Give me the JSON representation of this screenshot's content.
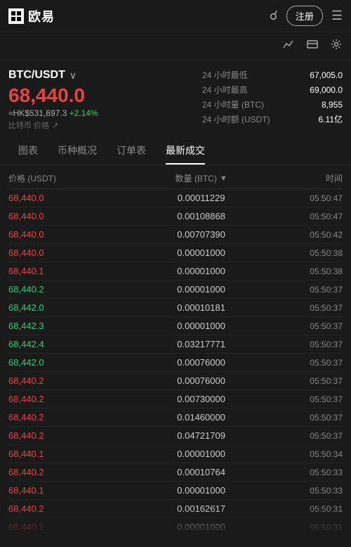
{
  "header": {
    "logo_text": "欧易",
    "register_label": "注册",
    "icons": [
      "search",
      "register",
      "menu"
    ]
  },
  "toolbar": {
    "icons": [
      "chart-line",
      "card",
      "settings"
    ]
  },
  "market": {
    "pair": "BTC/USDT",
    "pair_arrow": "∨",
    "price": "68,440.0",
    "price_hkd": "≈HK$531,697.3",
    "change": "+2.14%",
    "price_label": "比特币 价格",
    "stats": [
      {
        "label": "24 小时最低",
        "value": "67,005.0"
      },
      {
        "label": "24 小时最高",
        "value": "69,000.0"
      },
      {
        "label": "24 小时量 (BTC)",
        "value": "8,955"
      },
      {
        "label": "24 小时额 (USDT)",
        "value": "6.11亿"
      }
    ]
  },
  "tabs": [
    {
      "id": "chart",
      "label": "图表"
    },
    {
      "id": "overview",
      "label": "币种概况"
    },
    {
      "id": "orders",
      "label": "订单表"
    },
    {
      "id": "trades",
      "label": "最新成交",
      "active": true
    }
  ],
  "table": {
    "col_price": "价格 (USDT)",
    "col_qty": "数量 (BTC)",
    "col_time": "时间",
    "rows": [
      {
        "price": "68,440.0",
        "color": "red",
        "qty": "0.00011229",
        "time": "05:50:47"
      },
      {
        "price": "68,440.0",
        "color": "red",
        "qty": "0.00108868",
        "time": "05:50:47"
      },
      {
        "price": "68,440.0",
        "color": "red",
        "qty": "0.00707390",
        "time": "05:50:42"
      },
      {
        "price": "68,440.0",
        "color": "red",
        "qty": "0.00001000",
        "time": "05:50:38"
      },
      {
        "price": "68,440.1",
        "color": "red",
        "qty": "0.00001000",
        "time": "05:50:38"
      },
      {
        "price": "68,440.2",
        "color": "green",
        "qty": "0.00001000",
        "time": "05:50:37"
      },
      {
        "price": "68,442.0",
        "color": "green",
        "qty": "0.00010181",
        "time": "05:50:37"
      },
      {
        "price": "68,442.3",
        "color": "green",
        "qty": "0.00001000",
        "time": "05:50:37"
      },
      {
        "price": "68,442.4",
        "color": "green",
        "qty": "0.03217771",
        "time": "05:50:37"
      },
      {
        "price": "68,442.0",
        "color": "green",
        "qty": "0.00076000",
        "time": "05:50:37"
      },
      {
        "price": "68,440.2",
        "color": "red",
        "qty": "0.00076000",
        "time": "05:50:37"
      },
      {
        "price": "68,440.2",
        "color": "red",
        "qty": "0.00730000",
        "time": "05:50:37"
      },
      {
        "price": "68,440.2",
        "color": "red",
        "qty": "0.01460000",
        "time": "05:50:37"
      },
      {
        "price": "68,440.2",
        "color": "red",
        "qty": "0.04721709",
        "time": "05:50:37"
      },
      {
        "price": "68,440.1",
        "color": "red",
        "qty": "0.00001000",
        "time": "05:50:34"
      },
      {
        "price": "68,440.2",
        "color": "red",
        "qty": "0.00010764",
        "time": "05:50:33"
      },
      {
        "price": "68,440.1",
        "color": "red",
        "qty": "0.00001000",
        "time": "05:50:33"
      },
      {
        "price": "68,440.2",
        "color": "red",
        "qty": "0.00162617",
        "time": "05:50:31"
      },
      {
        "price": "68,440.1",
        "color": "red",
        "qty": "0.00001000",
        "time": "05:50:31"
      }
    ]
  }
}
